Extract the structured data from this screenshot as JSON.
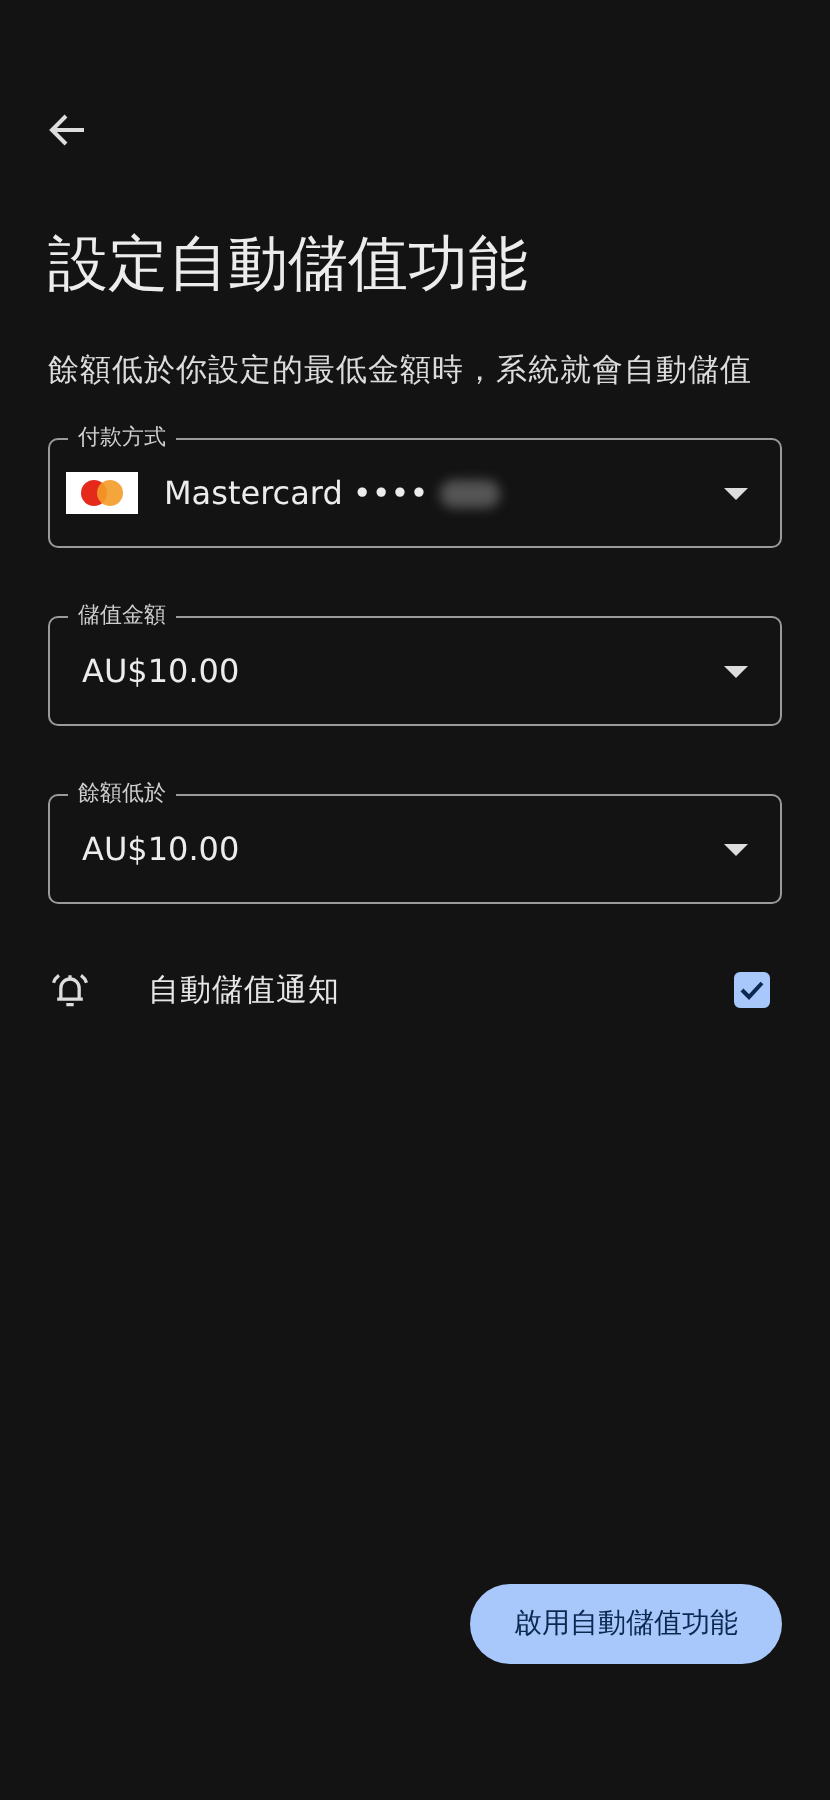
{
  "title": "設定自動儲值功能",
  "description": "餘額低於你設定的最低金額時，系統就會自動儲值",
  "fields": [
    {
      "kind": "card",
      "label": "付款方式",
      "value": "Mastercard ••••"
    },
    {
      "kind": "amount",
      "label": "儲值金額",
      "value": "AU$10.00"
    },
    {
      "kind": "amount",
      "label": "餘額低於",
      "value": "AU$10.00"
    }
  ],
  "notification": {
    "label": "自動儲值通知",
    "checked": true
  },
  "enable_button": "啟用自動儲值功能"
}
